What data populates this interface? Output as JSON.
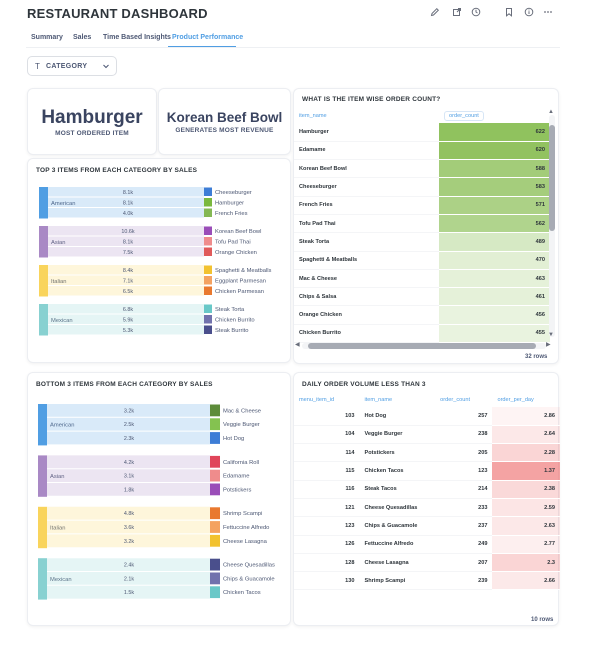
{
  "header": {
    "title": "RESTAURANT DASHBOARD"
  },
  "tabs": [
    {
      "label": "Summary"
    },
    {
      "label": "Sales"
    },
    {
      "label": "Time Based Insights"
    },
    {
      "label": "Product Performance"
    }
  ],
  "filter": {
    "type_glyph": "T",
    "label": "CATEGORY"
  },
  "kpi": [
    {
      "value": "Hamburger",
      "caption": "MOST ORDERED ITEM"
    },
    {
      "value": "Korean Beef Bowl",
      "caption": "GENERATES MOST REVENUE"
    }
  ],
  "order_count": {
    "title": "WHAT IS THE ITEM WISE ORDER COUNT?",
    "columns": [
      "item_name",
      "order_count"
    ],
    "rows": [
      {
        "item": "Hamburger",
        "count": 622
      },
      {
        "item": "Edamame",
        "count": 620
      },
      {
        "item": "Korean Beef Bowl",
        "count": 588
      },
      {
        "item": "Cheeseburger",
        "count": 583
      },
      {
        "item": "French Fries",
        "count": 571
      },
      {
        "item": "Tofu Pad Thai",
        "count": 562
      },
      {
        "item": "Steak Torta",
        "count": 489
      },
      {
        "item": "Spaghetti & Meatballs",
        "count": 470
      },
      {
        "item": "Mac & Cheese",
        "count": 463
      },
      {
        "item": "Chips & Salsa",
        "count": 461
      },
      {
        "item": "Orange Chicken",
        "count": 456
      },
      {
        "item": "Chicken Burrito",
        "count": 455
      }
    ],
    "footer": "32 rows"
  },
  "top3": {
    "title": "TOP 3 ITEMS FROM EACH CATEGORY BY SALES",
    "groups": [
      {
        "category": "American",
        "color": "#509ee3",
        "items": [
          {
            "label": "Cheeseburger",
            "value": "8.1k",
            "color": "#3d7dd6"
          },
          {
            "label": "Hamburger",
            "value": "8.1k",
            "color": "#7ab83e"
          },
          {
            "label": "French Fries",
            "value": "4.0k",
            "color": "#84b854"
          }
        ]
      },
      {
        "category": "Asian",
        "color": "#a989c5",
        "items": [
          {
            "label": "Korean Beef Bowl",
            "value": "10.6k",
            "color": "#9a4db8"
          },
          {
            "label": "Tofu Pad Thai",
            "value": "8.1k",
            "color": "#ef8c8c"
          },
          {
            "label": "Orange Chicken",
            "value": "7.5k",
            "color": "#e05a5a"
          }
        ]
      },
      {
        "category": "Italian",
        "color": "#f9d45c",
        "items": [
          {
            "label": "Spaghetti & Meatballs",
            "value": "8.4k",
            "color": "#f2c230"
          },
          {
            "label": "Eggplant Parmesan",
            "value": "7.1k",
            "color": "#f4a261"
          },
          {
            "label": "Chicken Parmesan",
            "value": "6.5k",
            "color": "#e9792f"
          }
        ]
      },
      {
        "category": "Mexican",
        "color": "#88d1d1",
        "items": [
          {
            "label": "Steak Torta",
            "value": "6.8k",
            "color": "#69c8c8"
          },
          {
            "label": "Chicken Burrito",
            "value": "5.9k",
            "color": "#7172ad"
          },
          {
            "label": "Steak Burrito",
            "value": "5.3k",
            "color": "#4a4f8c"
          }
        ]
      }
    ]
  },
  "bottom3": {
    "title": "BOTTOM 3 ITEMS FROM EACH CATEGORY BY SALES",
    "groups": [
      {
        "category": "American",
        "color": "#509ee3",
        "items": [
          {
            "label": "Mac & Cheese",
            "value": "3.2k",
            "color": "#5d8c3a"
          },
          {
            "label": "Veggie Burger",
            "value": "2.5k",
            "color": "#84c250"
          },
          {
            "label": "Hot Dog",
            "value": "2.3k",
            "color": "#3d7dd6"
          }
        ]
      },
      {
        "category": "Asian",
        "color": "#a989c5",
        "items": [
          {
            "label": "California Roll",
            "value": "4.2k",
            "color": "#e0455a"
          },
          {
            "label": "Edamame",
            "value": "3.1k",
            "color": "#ef8c8c"
          },
          {
            "label": "Potstickers",
            "value": "1.8k",
            "color": "#9a4db8"
          }
        ]
      },
      {
        "category": "Italian",
        "color": "#f9d45c",
        "items": [
          {
            "label": "Shrimp Scampi",
            "value": "4.8k",
            "color": "#e9792f"
          },
          {
            "label": "Fettuccine Alfredo",
            "value": "3.6k",
            "color": "#f4a261"
          },
          {
            "label": "Cheese Lasagna",
            "value": "3.2k",
            "color": "#f2c230"
          }
        ]
      },
      {
        "category": "Mexican",
        "color": "#88d1d1",
        "items": [
          {
            "label": "Cheese Quesadillas",
            "value": "2.4k",
            "color": "#4a4f8c"
          },
          {
            "label": "Chips & Guacamole",
            "value": "2.1k",
            "color": "#7172ad"
          },
          {
            "label": "Chicken Tacos",
            "value": "1.5k",
            "color": "#69c8c8"
          }
        ]
      }
    ]
  },
  "daily": {
    "title": "DAILY ORDER VOLUME LESS THAN 3",
    "columns": [
      "menu_item_id",
      "item_name",
      "order_count",
      "order_per_day"
    ],
    "rows": [
      {
        "id": 103,
        "item": "Hot Dog",
        "count": 257,
        "per_day": 2.86
      },
      {
        "id": 104,
        "item": "Veggie Burger",
        "count": 238,
        "per_day": 2.64
      },
      {
        "id": 114,
        "item": "Potstickers",
        "count": 205,
        "per_day": 2.28
      },
      {
        "id": 115,
        "item": "Chicken Tacos",
        "count": 123,
        "per_day": 1.37
      },
      {
        "id": 116,
        "item": "Steak Tacos",
        "count": 214,
        "per_day": 2.38
      },
      {
        "id": 121,
        "item": "Cheese Quesadillas",
        "count": 233,
        "per_day": 2.59
      },
      {
        "id": 123,
        "item": "Chips & Guacamole",
        "count": 237,
        "per_day": 2.63
      },
      {
        "id": 126,
        "item": "Fettuccine Alfredo",
        "count": 249,
        "per_day": 2.77
      },
      {
        "id": 128,
        "item": "Cheese Lasagna",
        "count": 207,
        "per_day": 2.3
      },
      {
        "id": 130,
        "item": "Shrimp Scampi",
        "count": 239,
        "per_day": 2.66
      }
    ],
    "footer": "10 rows"
  },
  "colors": {
    "accent": "#509ee3",
    "green": "#84bb4c",
    "red": "#ed6e6e"
  },
  "icons": [
    "pencil-icon",
    "share-icon",
    "clock-icon",
    "bookmark-icon",
    "info-icon",
    "more-icon"
  ]
}
